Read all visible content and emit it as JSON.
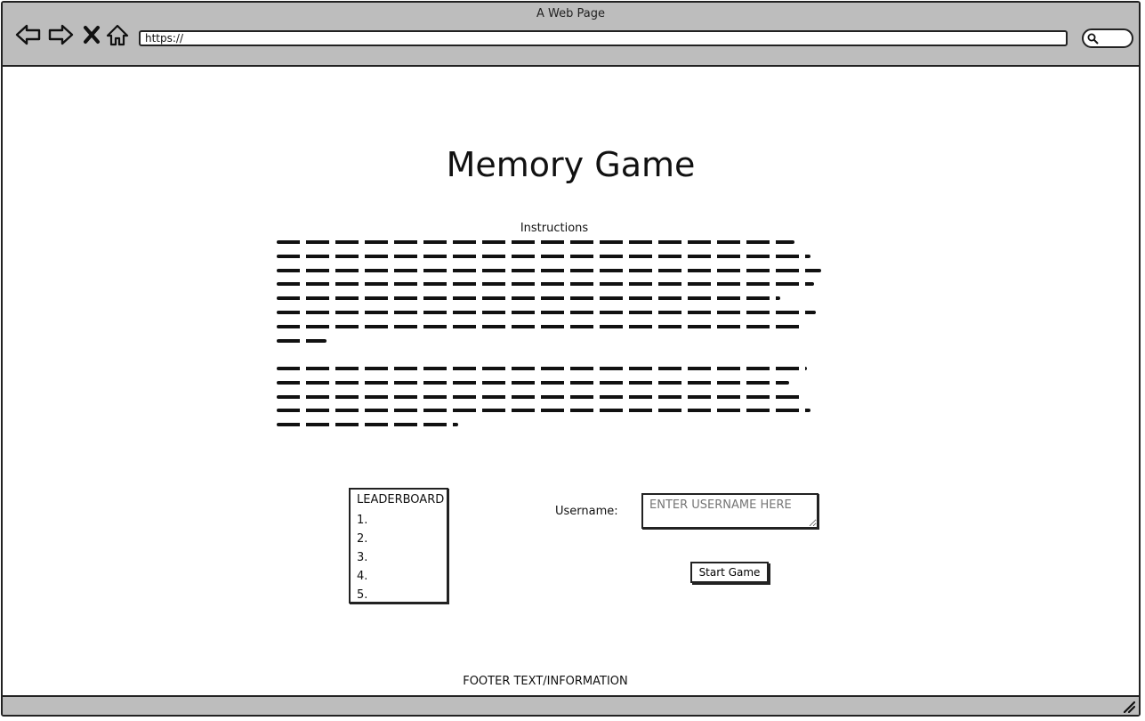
{
  "window": {
    "title": "A Web Page"
  },
  "browser": {
    "url": "https://",
    "icons": {
      "back": "back-arrow-icon",
      "forward": "forward-arrow-icon",
      "stop": "close-x-icon",
      "home": "home-icon",
      "search": "search-icon"
    }
  },
  "page": {
    "title": "Memory Game",
    "instructions_heading": "Instructions",
    "leaderboard": {
      "title": "LEADERBOARD",
      "rows": [
        "1.",
        "2.",
        "3.",
        "4.",
        "5."
      ]
    },
    "username": {
      "label": "Username:",
      "placeholder": "ENTER USERNAME HERE"
    },
    "start_button": "Start Game",
    "footer": "FOOTER TEXT/INFORMATION"
  }
}
